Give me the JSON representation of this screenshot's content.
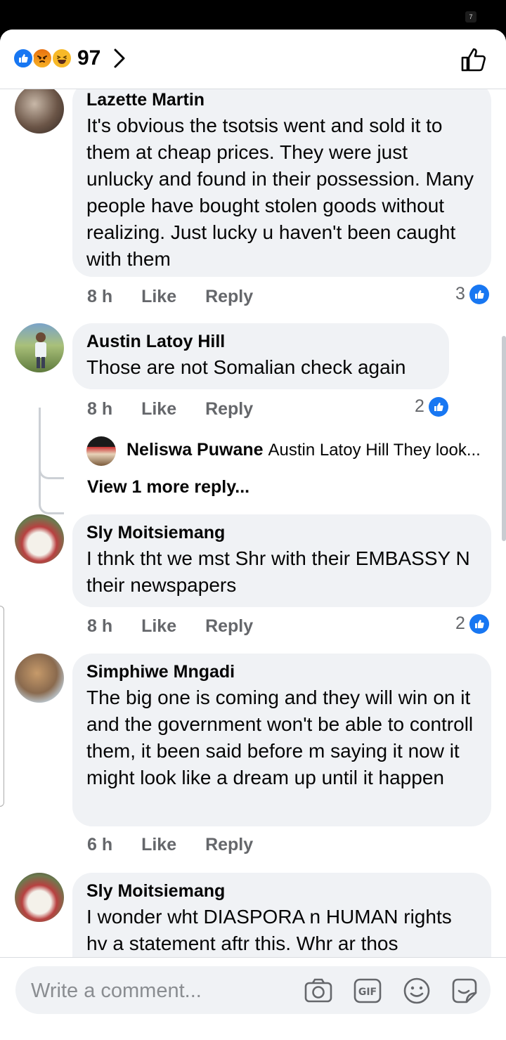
{
  "status_bar": {
    "badge": "7"
  },
  "reactions": {
    "count": "97"
  },
  "comments": [
    {
      "author": "Lazette Martin",
      "text": "It's obvious the tsotsis went and sold it to them at cheap prices. They were just unlucky and found in their possession. Many people have bought stolen goods without realizing. Just lucky u haven't been caught with them",
      "time": "8 h",
      "like_label": "Like",
      "reply_label": "Reply",
      "likes": "3"
    },
    {
      "author": "Austin Latoy Hill",
      "text": "Those are not Somalian check again",
      "time": "8 h",
      "like_label": "Like",
      "reply_label": "Reply",
      "likes": "2",
      "reply_preview": {
        "author": "Neliswa Puwane",
        "text": "Austin Latoy Hill They look..."
      },
      "view_more": "View 1 more reply..."
    },
    {
      "author": "Sly Moitsiemang",
      "text": "I thnk tht we mst Shr with their EMBASSY N their newspapers",
      "time": "8 h",
      "like_label": "Like",
      "reply_label": "Reply",
      "likes": "2"
    },
    {
      "author": "Simphiwe Mngadi",
      "text": "The big one is coming and they will win on it and the government won't be able to controll them, it been said before m saying it now it might look like a dream up until it happen",
      "time": "6 h",
      "like_label": "Like",
      "reply_label": "Reply",
      "likes": ""
    },
    {
      "author": "Sly Moitsiemang",
      "text": "I wonder wht DIASPORA n HUMAN rights hv a statement aftr this. Whr ar thos",
      "time": "",
      "like_label": "",
      "reply_label": "",
      "likes": ""
    }
  ],
  "composer": {
    "placeholder": "Write a comment..."
  },
  "icons": {
    "like": "like-icon",
    "angry": "angry-icon",
    "haha": "haha-icon",
    "camera": "camera-icon",
    "gif": "gif-icon",
    "emoji": "emoji-icon",
    "sticker": "sticker-icon"
  },
  "colors": {
    "accent": "#1877f2",
    "bubble": "#f0f2f5",
    "meta": "#65676b"
  }
}
